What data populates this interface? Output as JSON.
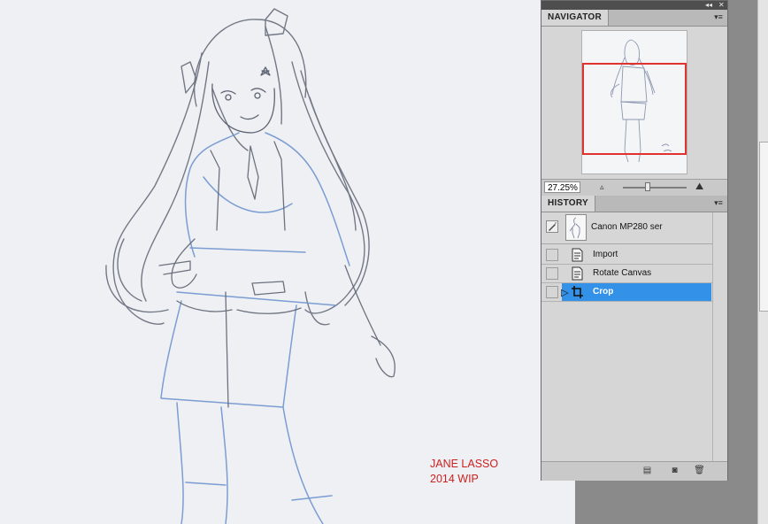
{
  "canvas": {
    "signature_line1": "JANE LASSO",
    "signature_line2": "2014 WIP",
    "signature_color": "#cc1f1f",
    "paper_color": "#eef0f4",
    "pencil_blue": "#6f95cf",
    "pencil_grey": "#5e6472"
  },
  "panel_strip": {
    "collapse_icon": "double-chevron-icon",
    "close_icon": "close-icon"
  },
  "navigator": {
    "tab_label": "NAVIGATOR",
    "menu_icon": "panel-menu-icon",
    "zoom_value": "27.25%",
    "zoom_slider_fraction": 0.42,
    "view_box_color": "#e0322f",
    "zoom_out_icon": "mountain-small-icon",
    "zoom_in_icon": "mountain-large-icon"
  },
  "history": {
    "tab_label": "HISTORY",
    "menu_icon": "panel-menu-icon",
    "snapshot_label": "Canon MP280 ser",
    "items": [
      {
        "label": "Import",
        "icon": "document-icon",
        "selected": false
      },
      {
        "label": "Rotate Canvas",
        "icon": "document-icon",
        "selected": false
      },
      {
        "label": "Crop",
        "icon": "crop-icon",
        "selected": true
      }
    ],
    "selection_color": "#3391e8",
    "footer_buttons": [
      "new-document-from-state-icon",
      "camera-snapshot-icon",
      "trash-icon"
    ]
  }
}
